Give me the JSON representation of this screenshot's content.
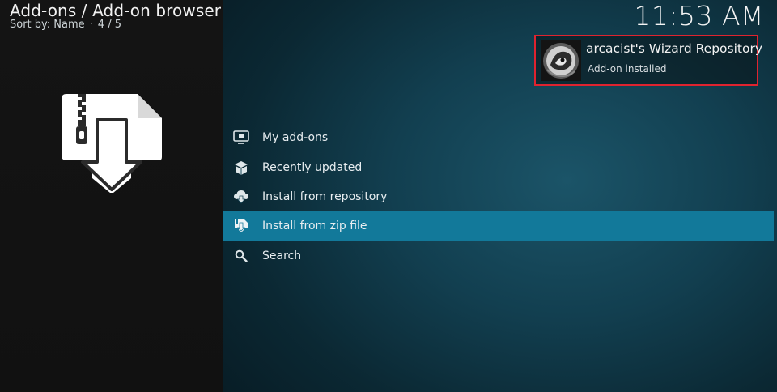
{
  "header": {
    "title": "Add-ons / Add-on browser",
    "sort_label": "Sort by: Name",
    "page_indicator": "4 / 5"
  },
  "clock": "11:53 AM",
  "notification": {
    "title": "arcacist's Wizard Repository",
    "message": "Add-on installed"
  },
  "menu": {
    "selected_index": 3,
    "items": [
      {
        "label": "My add-ons",
        "icon": "monitor-box-icon"
      },
      {
        "label": "Recently updated",
        "icon": "open-box-icon"
      },
      {
        "label": "Install from repository",
        "icon": "cloud-download-icon"
      },
      {
        "label": "Install from zip file",
        "icon": "zip-install-icon"
      },
      {
        "label": "Search",
        "icon": "search-icon"
      }
    ]
  },
  "colors": {
    "selection": "#12799a",
    "notification_border": "#e0232f",
    "sidebar_bg": "#141414"
  }
}
